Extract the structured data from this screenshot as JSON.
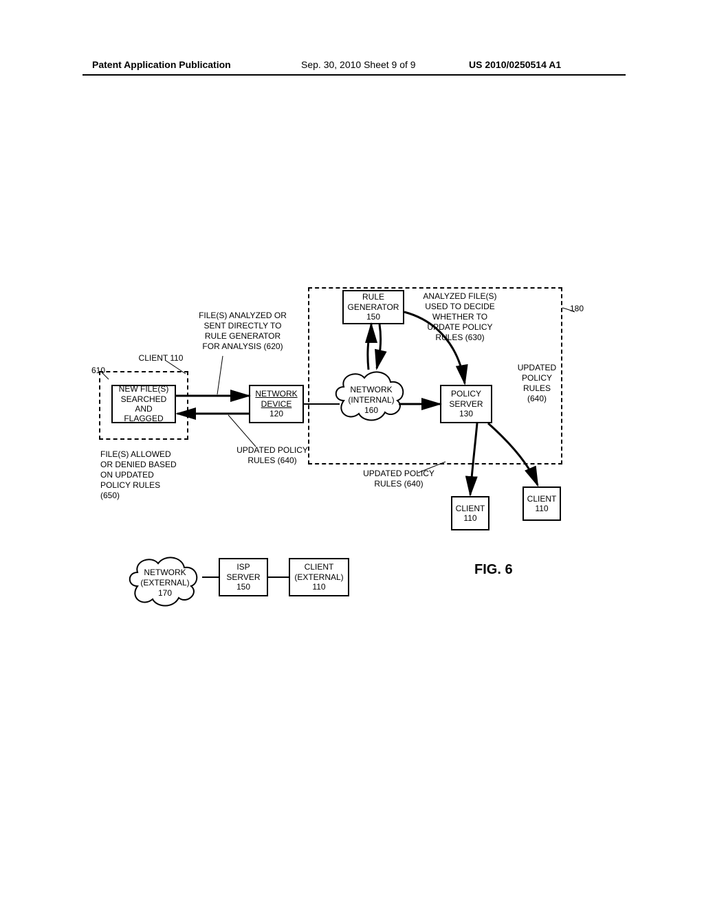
{
  "header": {
    "left": "Patent Application Publication",
    "mid": "Sep. 30, 2010  Sheet 9 of 9",
    "right": "US 2010/0250514 A1"
  },
  "fig": "FIG. 6",
  "labels": {
    "client110_tl": "CLIENT 110",
    "ref610": "610",
    "ref180": "180",
    "file_analyzed": "FILE(S) ANALYZED OR\nSENT DIRECTLY TO\nRULE GENERATOR\nFOR ANALYSIS (620)",
    "analyzed_decide": "ANALYZED FILE(S)\nUSED TO DECIDE\nWHETHER TO\nUPDATE POLICY\nRULES (630)",
    "updated_rules_right": "UPDATED\nPOLICY\nRULES\n(640)",
    "updated_rules_mid": "UPDATED POLICY\nRULES (640)",
    "updated_rules_mid2": "UPDATED POLICY\nRULES (640)",
    "allowed_denied": "FILE(S) ALLOWED\nOR DENIED BASED\nON UPDATED\nPOLICY RULES\n(650)"
  },
  "boxes": {
    "newfiles": "NEW FILE(S)\nSEARCHED\nAND FLAGGED",
    "network_device": "NETWORK\nDEVICE\n120",
    "network_internal": "NETWORK\n(INTERNAL)\n160",
    "rule_generator": "RULE\nGENERATOR\n150",
    "policy_server": "POLICY\nSERVER\n130",
    "client110_a": "CLIENT\n110",
    "client110_b": "CLIENT\n110",
    "network_external": "NETWORK\n(EXTERNAL)\n170",
    "isp_server": "ISP\nSERVER\n150",
    "client_external": "CLIENT\n(EXTERNAL)\n110"
  }
}
